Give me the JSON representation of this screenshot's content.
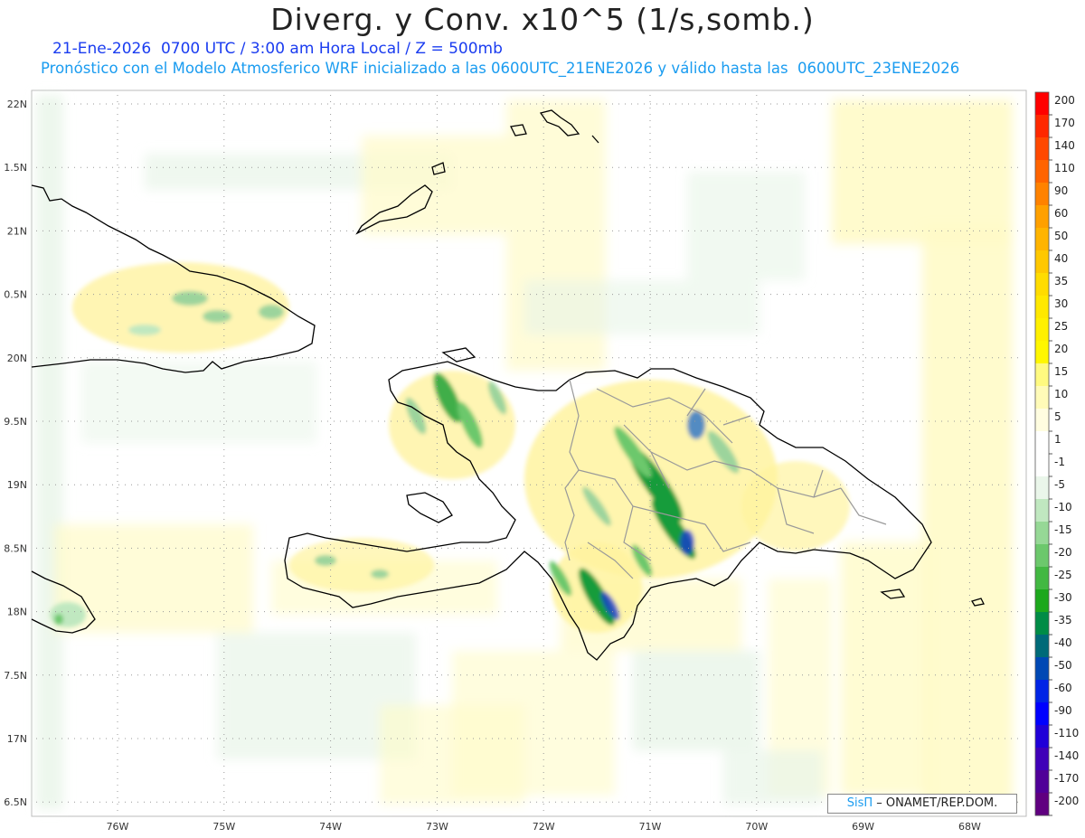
{
  "header": {
    "title": "Diverg. y Conv. x10^5 (1/s,somb.)",
    "line1": "21-Ene-2026  0700 UTC / 3:00 am Hora Local / Z = 500mb",
    "line2": "Pronóstico con el Modelo Atmosferico WRF inicializado a las 0600UTC_21ENE2026 y válido hasta las  0600UTC_23ENE2026"
  },
  "map": {
    "lat_labels": [
      "22N",
      "1.5N",
      "21N",
      "0.5N",
      "20N",
      "9.5N",
      "19N",
      "8.5N",
      "18N",
      "7.5N",
      "17N",
      "6.5N"
    ],
    "lon_labels": [
      "76W",
      "75W",
      "74W",
      "73W",
      "72W",
      "71W",
      "70W",
      "69W",
      "68W"
    ],
    "colors": {
      "land_outline": "#000000",
      "provinces": "#999999",
      "grid": "#aaaaaa",
      "light_yellow": "#fffbc8",
      "light_green": "#e6f5e6"
    }
  },
  "colorbar": {
    "labels": [
      "200",
      "170",
      "140",
      "110",
      "90",
      "60",
      "50",
      "40",
      "35",
      "30",
      "25",
      "20",
      "15",
      "10",
      "5",
      "1",
      "-1",
      "-5",
      "-10",
      "-15",
      "-20",
      "-25",
      "-30",
      "-35",
      "-40",
      "-50",
      "-60",
      "-90",
      "-110",
      "-140",
      "-170",
      "-200"
    ],
    "colors": [
      "#ff0000",
      "#ff2800",
      "#ff4800",
      "#ff6400",
      "#ff8200",
      "#ffa000",
      "#ffb400",
      "#ffc800",
      "#ffdc00",
      "#ffe800",
      "#fff000",
      "#fff700",
      "#fffa80",
      "#fffbb8",
      "#fffde0",
      "#ffffff",
      "#ffffff",
      "#eaf6ea",
      "#c0e8c0",
      "#96d896",
      "#6cc86c",
      "#42b842",
      "#1ca81c",
      "#008c46",
      "#006a78",
      "#0048b4",
      "#0024e6",
      "#0000ff",
      "#2000d8",
      "#4000b8",
      "#500098",
      "#600080"
    ]
  },
  "credit": {
    "brand": "SisΠ",
    "org": " – ONAMET/REP.DOM."
  }
}
